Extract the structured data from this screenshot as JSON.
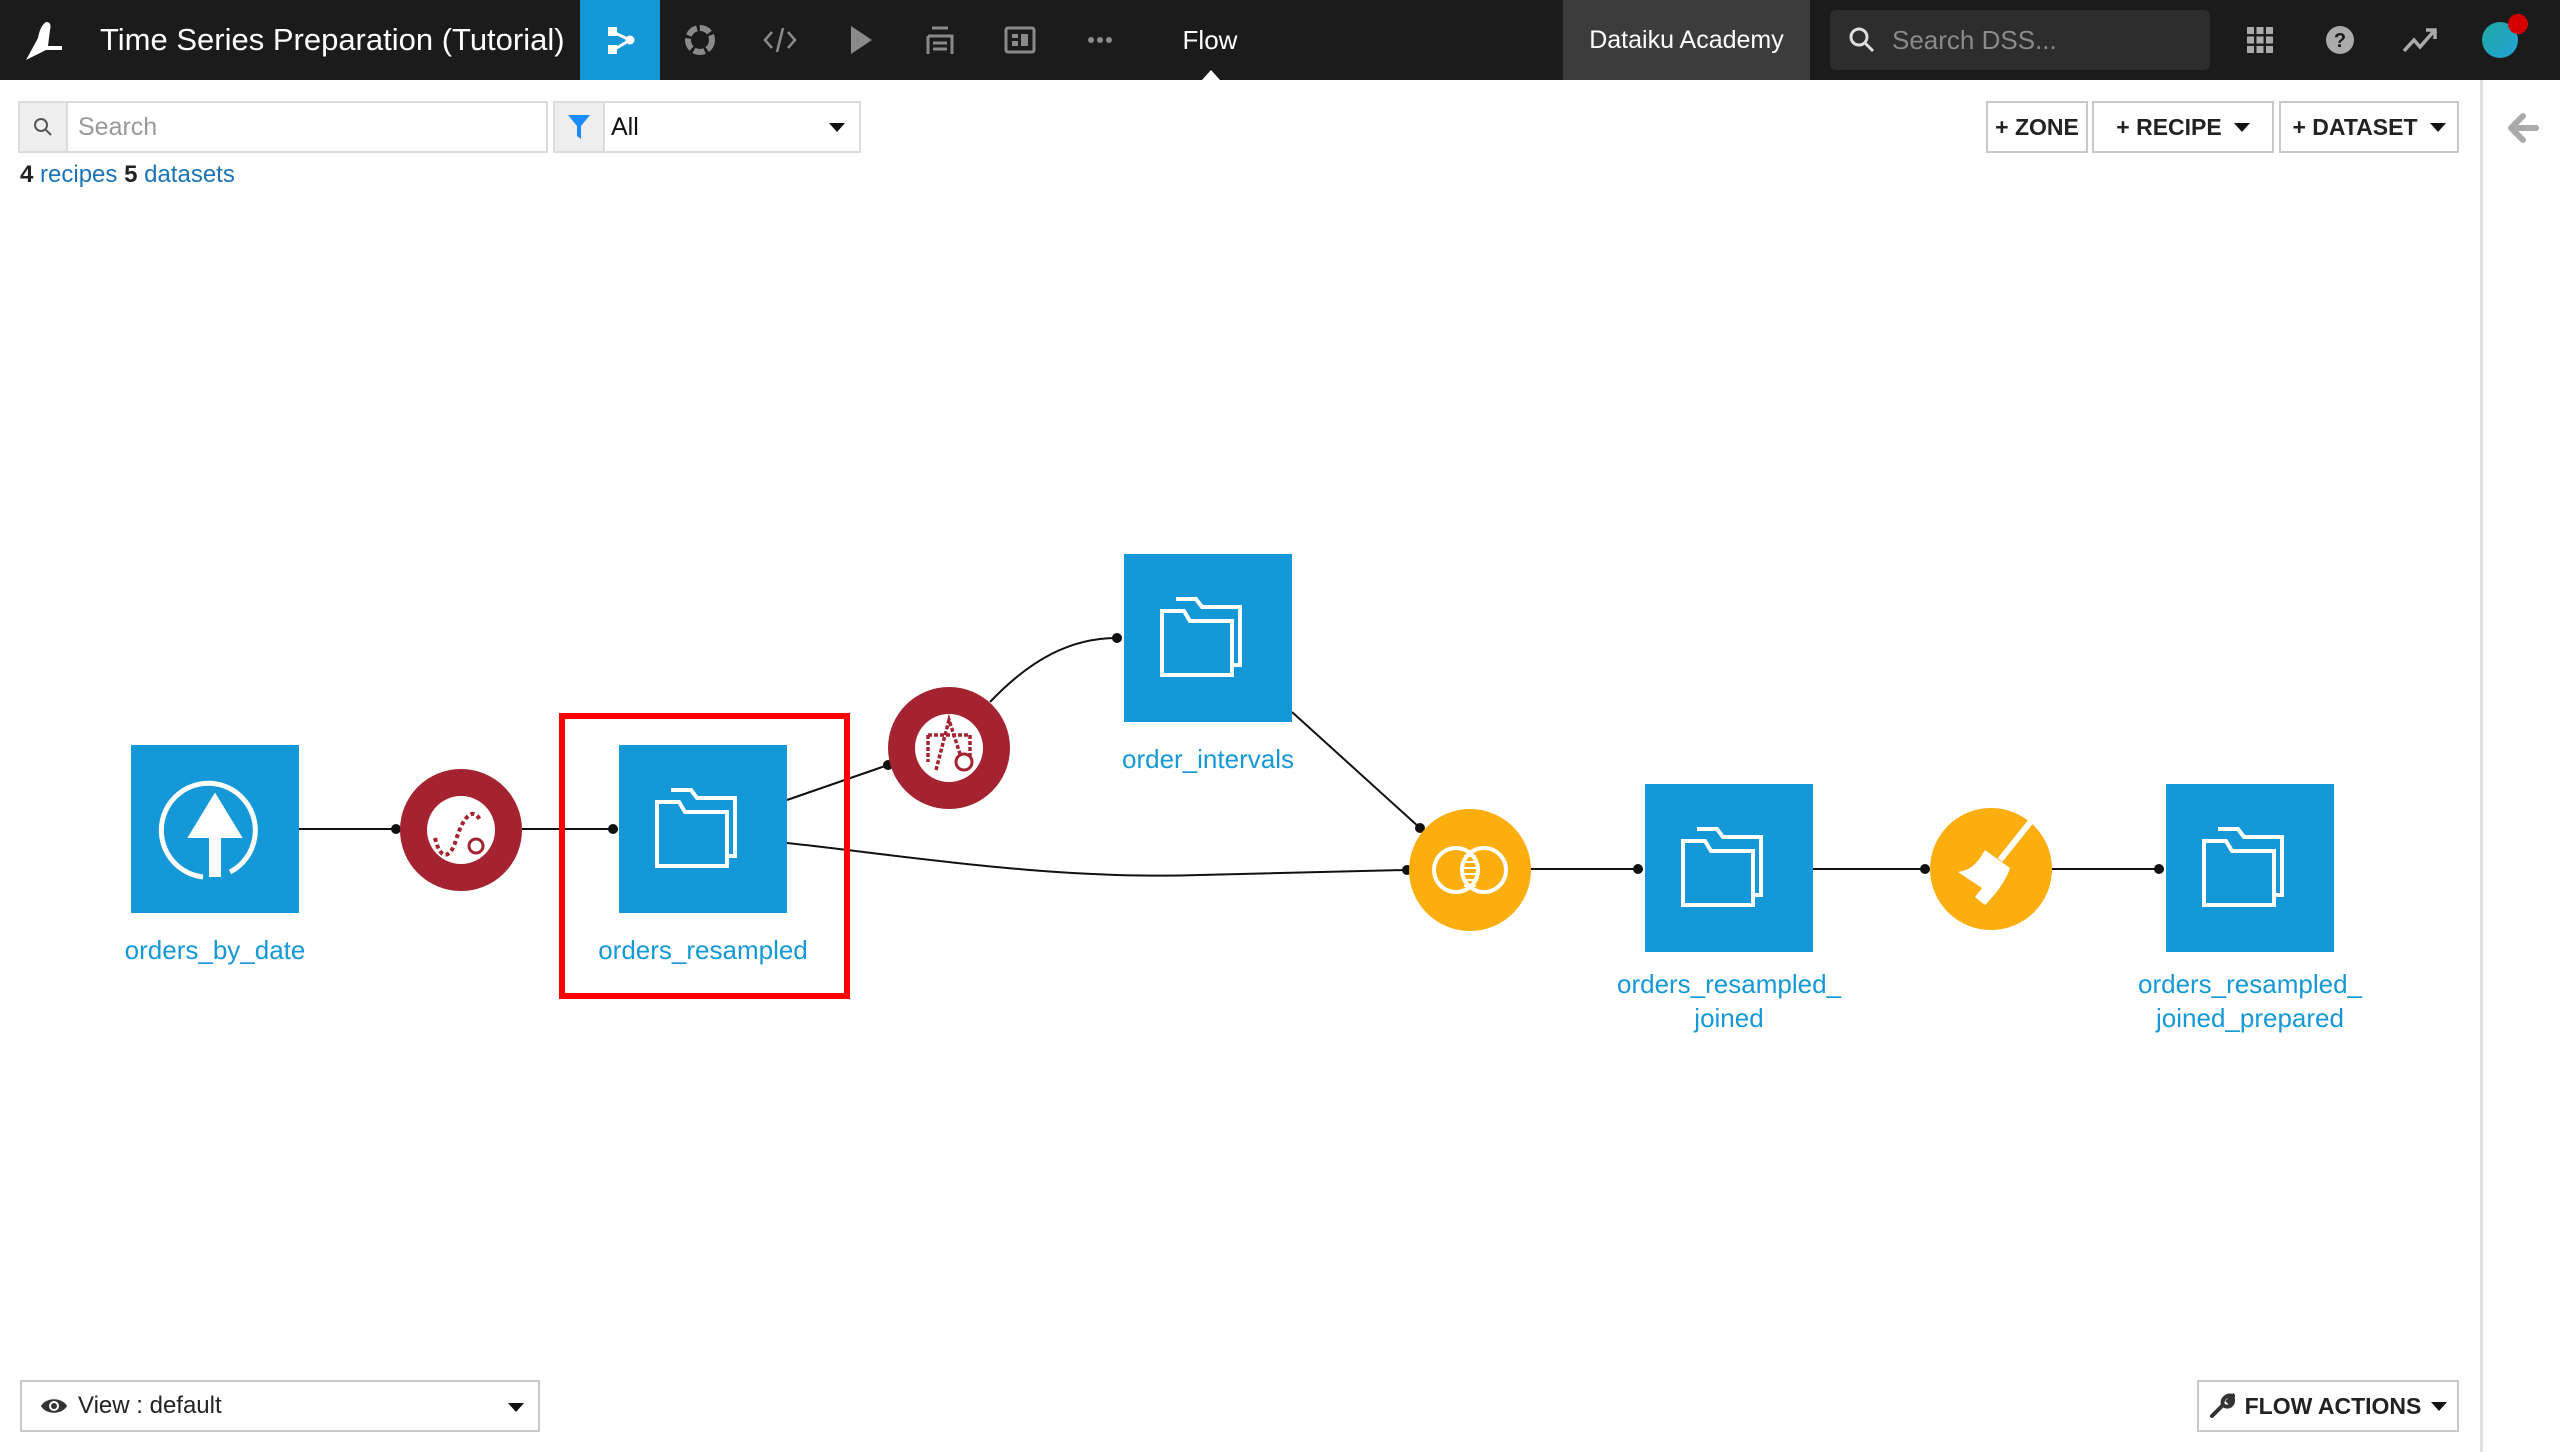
{
  "topbar": {
    "project_title": "Time Series Preparation (Tutorial)",
    "nav_items": [
      {
        "name": "flow",
        "icon": "flow-icon",
        "active": true
      },
      {
        "name": "lab",
        "icon": "lab-icon",
        "active": false
      },
      {
        "name": "code",
        "icon": "code-icon",
        "active": false
      },
      {
        "name": "jobs",
        "icon": "play-icon",
        "active": false
      },
      {
        "name": "deploy",
        "icon": "stack-icon",
        "active": false
      },
      {
        "name": "dashboards",
        "icon": "dashboard-icon",
        "active": false
      },
      {
        "name": "more",
        "icon": "more-icon",
        "active": false
      }
    ],
    "current_section": "Flow",
    "workspace": "Dataiku Academy",
    "search_placeholder": "Search DSS...",
    "notification_color": "#d40000"
  },
  "toolbar": {
    "search_placeholder": "Search",
    "filter_value": "All",
    "stats": {
      "recipes_count": "4",
      "recipes_label": "recipes",
      "datasets_count": "5",
      "datasets_label": "datasets"
    },
    "zone_button": "+ ZONE",
    "recipe_button": "+ RECIPE",
    "dataset_button": "+ DATASET"
  },
  "flow": {
    "datasets": [
      {
        "id": "orders_by_date",
        "label": "orders_by_date",
        "type": "uploaded",
        "selected": false
      },
      {
        "id": "orders_resampled",
        "label": "orders_resampled",
        "type": "managed",
        "selected": true
      },
      {
        "id": "order_intervals",
        "label": "order_intervals",
        "type": "managed",
        "selected": false
      },
      {
        "id": "orders_resampled_joined",
        "label": "orders_resampled_\njoined",
        "type": "managed",
        "selected": false
      },
      {
        "id": "orders_resampled_joined_prepared",
        "label": "orders_resampled_\njoined_prepared",
        "type": "managed",
        "selected": false
      }
    ],
    "recipes": [
      {
        "id": "resample",
        "kind": "time-series-resampling",
        "color": "#a52330"
      },
      {
        "id": "intervals",
        "kind": "time-series-interval-extraction",
        "color": "#a52330"
      },
      {
        "id": "join",
        "kind": "join",
        "color": "#fbae0e"
      },
      {
        "id": "prepare",
        "kind": "prepare",
        "color": "#fbae0e"
      }
    ],
    "edges": [
      [
        "orders_by_date",
        "resample"
      ],
      [
        "resample",
        "orders_resampled"
      ],
      [
        "orders_resampled",
        "intervals"
      ],
      [
        "intervals",
        "order_intervals"
      ],
      [
        "orders_resampled",
        "join"
      ],
      [
        "order_intervals",
        "join"
      ],
      [
        "join",
        "orders_resampled_joined"
      ],
      [
        "orders_resampled_joined",
        "prepare"
      ],
      [
        "prepare",
        "orders_resampled_joined_prepared"
      ]
    ],
    "dataset_color": "#1598d8",
    "selection_color": "#ff0000"
  },
  "footer": {
    "view_label": "View : default",
    "flow_actions_label": "FLOW ACTIONS"
  }
}
